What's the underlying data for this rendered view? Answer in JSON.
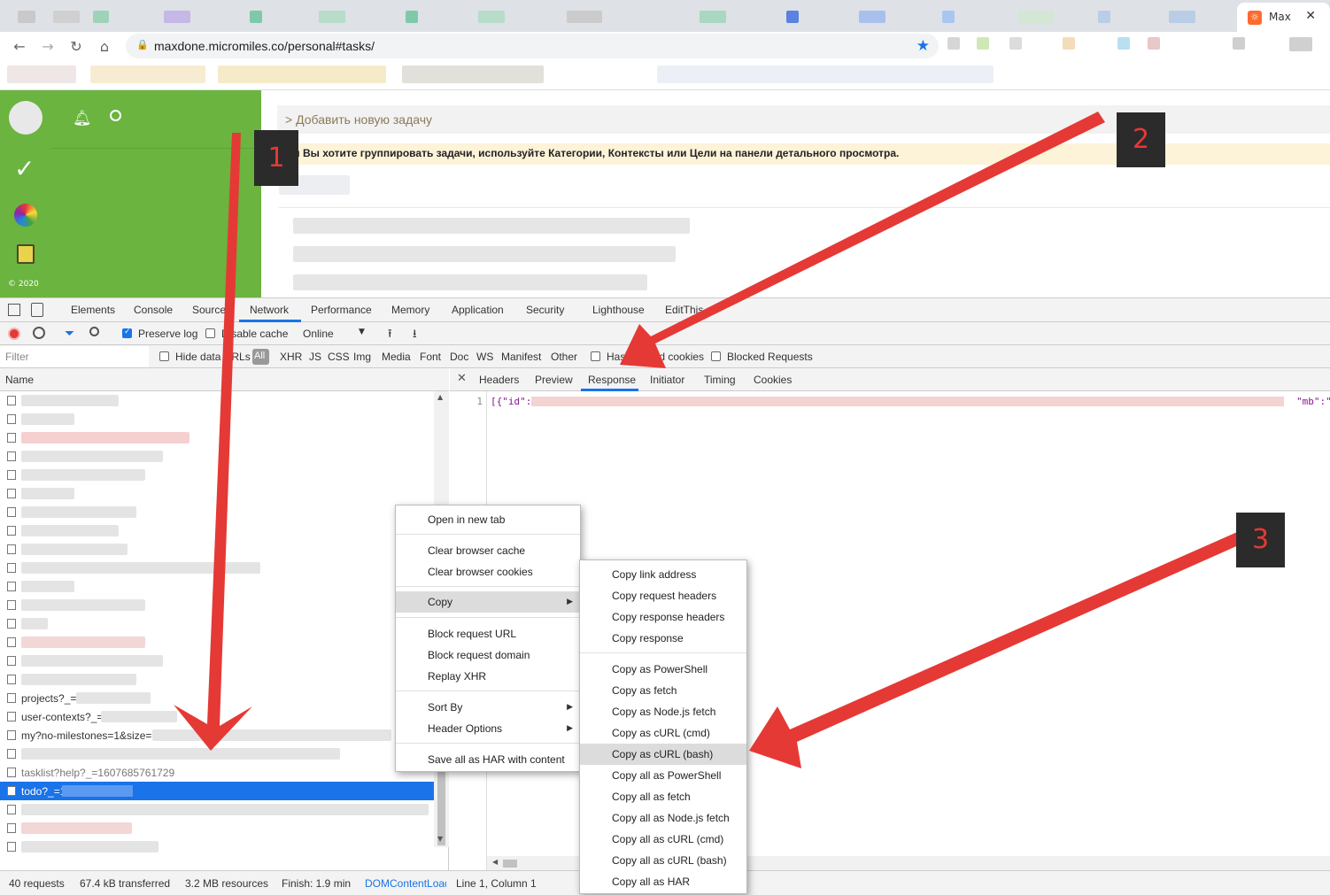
{
  "browser": {
    "tab_title": "Max",
    "tab_favicon": "maxdone-favicon-icon",
    "close_glyph": "✕",
    "url": "maxdone.micromiles.co/personal#tasks/"
  },
  "app": {
    "copyright": "© 2020",
    "add_task": "> Добавить новую задачу",
    "hint": "Если Вы хотите группировать задачи, используйте Категории, Контексты или Цели на панели детального просмотра."
  },
  "devtools": {
    "tabs": [
      "Elements",
      "Console",
      "Sources",
      "Network",
      "Performance",
      "Memory",
      "Application",
      "Security",
      "Lighthouse",
      "EditThis"
    ],
    "toolbar": {
      "preserve_log": "Preserve log",
      "disable_cache": "Disable cache",
      "throttling": "Online"
    },
    "filter": {
      "placeholder": "Filter",
      "hide_data_urls": "Hide data URLs",
      "types": [
        "All",
        "XHR",
        "JS",
        "CSS",
        "Img",
        "Media",
        "Font",
        "Doc",
        "WS",
        "Manifest",
        "Other"
      ],
      "has_blocked_cookies": "Has blocked cookies",
      "blocked_requests": "Blocked Requests"
    },
    "list": {
      "header": "Name",
      "visible_requests": [
        "projects?_=",
        "user-contexts?_=",
        "my?no-milestones=1&size=",
        "tasklist?help?_=1607685761729",
        "todo?_=1"
      ]
    },
    "status": {
      "requests": "40 requests",
      "transferred": "67.4 kB transferred",
      "resources": "3.2 MB resources",
      "finish": "Finish: 1.9 min",
      "dom_content_loaded": "DOMContentLoaded",
      "cursor": "Line 1, Column 1"
    },
    "detail_tabs": [
      "Headers",
      "Preview",
      "Response",
      "Initiator",
      "Timing",
      "Cookies"
    ],
    "response": {
      "line_number": "1",
      "line_start": "[{\"id\":",
      "line_end": "\"mb\":\""
    }
  },
  "context_menu": {
    "items": [
      "Open in new tab",
      "Clear browser cache",
      "Clear browser cookies",
      "Copy",
      "Block request URL",
      "Block request domain",
      "Replay XHR",
      "Sort By",
      "Header Options",
      "Save all as HAR with content"
    ]
  },
  "copy_submenu": {
    "items": [
      "Copy link address",
      "Copy request headers",
      "Copy response headers",
      "Copy response",
      "Copy as PowerShell",
      "Copy as fetch",
      "Copy as Node.js fetch",
      "Copy as cURL (cmd)",
      "Copy as cURL (bash)",
      "Copy all as PowerShell",
      "Copy all as fetch",
      "Copy all as Node.js fetch",
      "Copy all as cURL (cmd)",
      "Copy all as cURL (bash)",
      "Copy all as HAR"
    ],
    "highlighted": "Copy as cURL (bash)"
  },
  "annotations": {
    "badges": [
      "1",
      "2",
      "3"
    ],
    "arrow_color": "#e53935"
  },
  "colors": {
    "app_green": "#6ab43f",
    "selection_blue": "#1a73e8",
    "hint_bg": "#fdf3d9"
  }
}
